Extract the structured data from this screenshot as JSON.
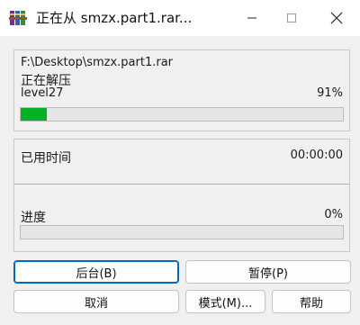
{
  "window": {
    "title": "正在从 smzx.part1.rar..."
  },
  "details": {
    "path": "F:\\Desktop\\smzx.part1.rar",
    "status": "正在解压",
    "current_file": "level27",
    "file_percent_label": "91%",
    "file_progress": 0.08
  },
  "stats": {
    "elapsed_label": "已用时间",
    "elapsed_value": "00:00:00",
    "progress_label": "进度",
    "progress_value": "0%",
    "total_progress": 0.0
  },
  "buttons": {
    "background": "后台(B)",
    "pause": "暂停(P)",
    "cancel": "取消",
    "mode": "模式(M)...",
    "help": "帮助"
  },
  "colors": {
    "progress_fill": "#06b025",
    "default_button_border": "#0067c0"
  },
  "icons": {
    "app": "winrar-books-icon",
    "minimize": "minimize-icon",
    "maximize": "maximize-icon",
    "close": "close-icon"
  }
}
